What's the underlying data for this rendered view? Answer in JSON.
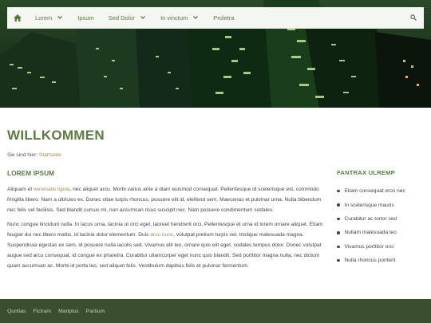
{
  "nav": {
    "items": [
      {
        "label": "Lorem",
        "has_dropdown": true
      },
      {
        "label": "Ipsum",
        "has_dropdown": false
      },
      {
        "label": "Sed Dolor",
        "has_dropdown": true
      },
      {
        "label": "In vinctum",
        "has_dropdown": true
      },
      {
        "label": "Proletra",
        "has_dropdown": false
      }
    ],
    "home_icon": "home-icon",
    "search_icon": "search-icon"
  },
  "page": {
    "title": "WILLKOMMEN",
    "breadcrumb_prefix": "Sie sind hier:",
    "breadcrumb_link": "Startseite"
  },
  "main": {
    "heading": "LOREM IPSUM",
    "p1_a": "Aliquam et ",
    "p1_link": "venenatis ligula",
    "p1_b": ", nec aliquet arcu. Morbi varius ante a diam euismod consequat. Pellentesque id scelerisque est, commodo fringilla libero. Nam a ultricies ex. Donec vitae turpis rhoncus, posuere elit id, eleifend sem. Maecenas et pulvinar urna. Nulla bibendum nec felis vel facilisis. Sed blandit cursus mi, non accumsan risus suscipit nec. Nam posuere condimentum sodales.",
    "p2_a": "Nunc congue tincidunt nulla. In lacus urna, lacinia ut orci eget, laoreet hendrerit orci. Pellentesque et urna id lorem ornare aliquet. Etiam feugiat dui nec libero mattis, id lacinia dolor elementum. Duis ",
    "p2_link": "arcu nunc",
    "p2_b": ", volutpat pretium turpis vel, tristique malesuada magna. Suspendisse egestas ex sem, id posuere nulla iaculis sed. Vivamus elit leo, ornare quis elit eget, sodales tempus dolor. Donec volutpat augue sed arcu consequat, id congue ex pharetra. Curabitur ullamcorper eget nunc quis blandit. Sed porttitor magna nulla, nec dictum quam accumsan ac. Morbi id porta leo, sed aliquet felis. Vestibulum dapibus felis et pulvinar fermentum."
  },
  "sidebar": {
    "heading": "FANTRAX ULREMP",
    "items": [
      "Etiam consequat eros nec",
      "In scelerisque mauris",
      "Curabitur ac tortor sed",
      "Nullam malesuada leo",
      "Vivamus porttitor orci",
      "Nulla rhoncus pontent"
    ]
  },
  "footer": {
    "links": [
      "Quntias",
      "Fictram",
      "Mariplus",
      "Partium"
    ]
  },
  "colors": {
    "accent": "#5e7a43",
    "link": "#a58a52",
    "footer_bg": "#3b4f2c"
  }
}
